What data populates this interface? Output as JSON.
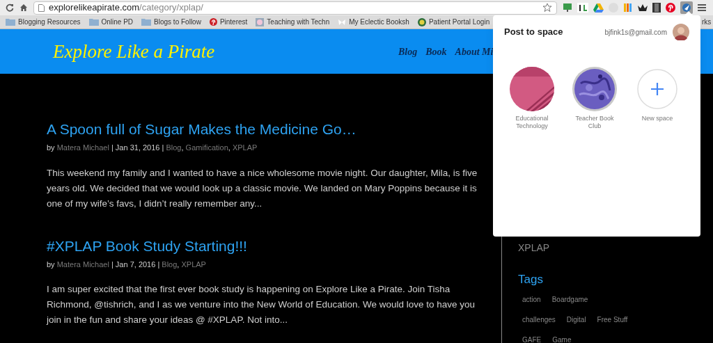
{
  "browser": {
    "url_host": "explorelikeapirate.com",
    "url_path": "/category/xplap/",
    "bookmarks": [
      {
        "label": "Blogging Resources",
        "kind": "folder"
      },
      {
        "label": "Online PD",
        "kind": "folder"
      },
      {
        "label": "Blogs to Follow",
        "kind": "folder"
      },
      {
        "label": "Pinterest",
        "kind": "pin"
      },
      {
        "label": "Teaching with Techn",
        "kind": "site"
      },
      {
        "label": "My Eclectic Booksh",
        "kind": "butterfly"
      },
      {
        "label": "Patient Portal Login",
        "kind": "globe"
      },
      {
        "label": "rks",
        "kind": "plain"
      }
    ]
  },
  "site": {
    "title": "Explore Like a Pirate",
    "nav": [
      "Blog",
      "Book",
      "About Mi"
    ]
  },
  "posts": [
    {
      "title": "A Spoon full of Sugar Makes the Medicine Go…",
      "meta": [
        {
          "kind": "text",
          "text": "by "
        },
        {
          "kind": "link",
          "text": "Matera Michael"
        },
        {
          "kind": "text",
          "text": " | Jan 31, 2016 | "
        },
        {
          "kind": "link",
          "text": "Blog"
        },
        {
          "kind": "text",
          "text": ", "
        },
        {
          "kind": "link",
          "text": "Gamification"
        },
        {
          "kind": "text",
          "text": ", "
        },
        {
          "kind": "link",
          "text": "XPLAP"
        }
      ],
      "excerpt": "This weekend my family and I wanted to have a nice wholesome movie night. Our daughter, Mila, is five years old. We decided that we would look up a classic movie. We landed on Mary Poppins because it is one of my wife’s favs, I didn’t really remember any..."
    },
    {
      "title": "#XPLAP Book Study Starting!!!",
      "meta": [
        {
          "kind": "text",
          "text": "by "
        },
        {
          "kind": "link",
          "text": "Matera Michael"
        },
        {
          "kind": "text",
          "text": " | Jan 7, 2016 | "
        },
        {
          "kind": "link",
          "text": "Blog"
        },
        {
          "kind": "text",
          "text": ", "
        },
        {
          "kind": "link",
          "text": "XPLAP"
        }
      ],
      "excerpt": "I am super excited that the first ever book study is happening on Explore Like a Pirate. Join Tisha Richmond, @tishrich, and I as we venture into the New World of Education. We would love to have you join in the fun and share your ideas @ #XPLAP. Not into..."
    }
  ],
  "sidebar": {
    "category": "XPLAP",
    "tags_heading": "Tags",
    "tag_rows": [
      [
        "action",
        "Boardgame"
      ],
      [
        "challenges",
        "Digital",
        "Free Stuff"
      ],
      [
        "GAFE",
        "Game"
      ]
    ]
  },
  "popup": {
    "title": "Post to space",
    "email": "bjfink1s@gmail.com",
    "spaces": [
      {
        "label": "Educational Technology",
        "kind": "stripes"
      },
      {
        "label": "Teacher Book Club",
        "kind": "swirl"
      },
      {
        "label": "New space",
        "kind": "new"
      }
    ]
  }
}
